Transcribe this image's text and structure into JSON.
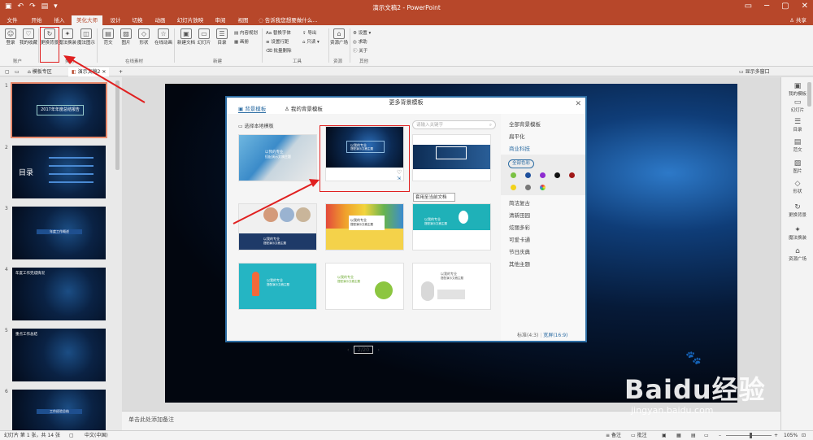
{
  "app": {
    "title": "演示文稿2 - PowerPoint",
    "share": "共享",
    "tell_me": "告诉我您想要做什么..."
  },
  "tabs": [
    "文件",
    "开始",
    "插入",
    "美化大师",
    "设计",
    "切换",
    "动画",
    "幻灯片放映",
    "审阅",
    "视图"
  ],
  "ribbon": {
    "account": {
      "login": "登录",
      "my_collection": "我的收藏",
      "group": "账户"
    },
    "beautify": {
      "change_bg": "更换背景",
      "magic_change": "魔法换装",
      "magic_show": "魔法图示",
      "group": "美化"
    },
    "online": {
      "fanwen": "范文",
      "image": "图片",
      "shape": "形状",
      "online_anim": "在线动画",
      "group": "在线素材"
    },
    "new": {
      "new_doc": "新建文档",
      "slide": "幻灯片",
      "toc": "目录",
      "content_plan": "内容规划",
      "album": "画册",
      "group": "新建"
    },
    "tools": {
      "replace_font": "替换字体",
      "set_line": "设置行距",
      "batch_delete": "批量删除",
      "export": "导出",
      "only": "只读",
      "group": "工具"
    },
    "resource": {
      "plaza": "资源广场",
      "group": "资源"
    },
    "other": {
      "settings": "设置",
      "help": "求助",
      "about": "关于",
      "group": "其他"
    }
  },
  "doc_tabs": {
    "home": "模板专区",
    "doc": "演示文稿2",
    "show_more": "显示多窗口"
  },
  "slides": [
    {
      "num": "1",
      "title": "2017年年度总结报告"
    },
    {
      "num": "2",
      "title": "目录"
    },
    {
      "num": "3",
      "title": "年度工作概述"
    },
    {
      "num": "4",
      "title": "年度工作完成情况"
    },
    {
      "num": "5",
      "title": "重点工作总结"
    },
    {
      "num": "6",
      "title": "工作经验总结"
    }
  ],
  "dialog": {
    "title": "更多背景模板",
    "tab_bg": "背景模板",
    "tab_mine": "我的背景模板",
    "local": "选择本地模板",
    "search_placeholder": "请输入关键字",
    "apply_tip": "套用至当前文档",
    "page": "2/20",
    "ratio_std": "标准(4:3)",
    "ratio_wide": "宽屏(16:9)",
    "categories": [
      "全部背景模板",
      "扁平化",
      "商业科技"
    ],
    "color_label": "全部色彩",
    "styles": [
      "简洁复古",
      "清新田园",
      "炫丽多彩",
      "可爱卡通",
      "节日庆典",
      "其他主题"
    ],
    "templates": [
      {
        "title": "以我的专业",
        "subtitle": "搭配演示文稿主题"
      },
      {
        "title": "以我的专业",
        "subtitle": "搭配演示文稿主题"
      },
      {
        "title": "",
        "subtitle": ""
      },
      {
        "title": "以我的专业",
        "subtitle": "搭配演示文稿主题"
      },
      {
        "title": "以我的专业",
        "subtitle": "搭配演示文稿主题"
      },
      {
        "title": "以我的专业",
        "subtitle": "搭配演示文稿主题"
      },
      {
        "title": "以我的专业",
        "subtitle": "搭配演示文稿主题"
      },
      {
        "title": "以我的专业",
        "subtitle": "搭配演示文稿主题"
      },
      {
        "title": "以我的专业",
        "subtitle": "搭配演示文稿主题"
      }
    ]
  },
  "right_panel": [
    "我的模板",
    "幻灯片",
    "目录",
    "范文",
    "图片",
    "形状",
    "更换背景",
    "魔法换装",
    "资源广场"
  ],
  "notes_placeholder": "单击此处添加备注",
  "status": {
    "slide_info": "幻灯片 第 1 张，共 14 张",
    "lang": "中文(中国)",
    "notes": "备注",
    "comments": "批注",
    "zoom": "105%"
  },
  "watermark": {
    "brand": "Baidu经验",
    "url": "jingyan.baidu.com"
  },
  "colors": {
    "accent": "#b7472a",
    "highlight": "#e02020",
    "dialog": "#2d6da3"
  }
}
